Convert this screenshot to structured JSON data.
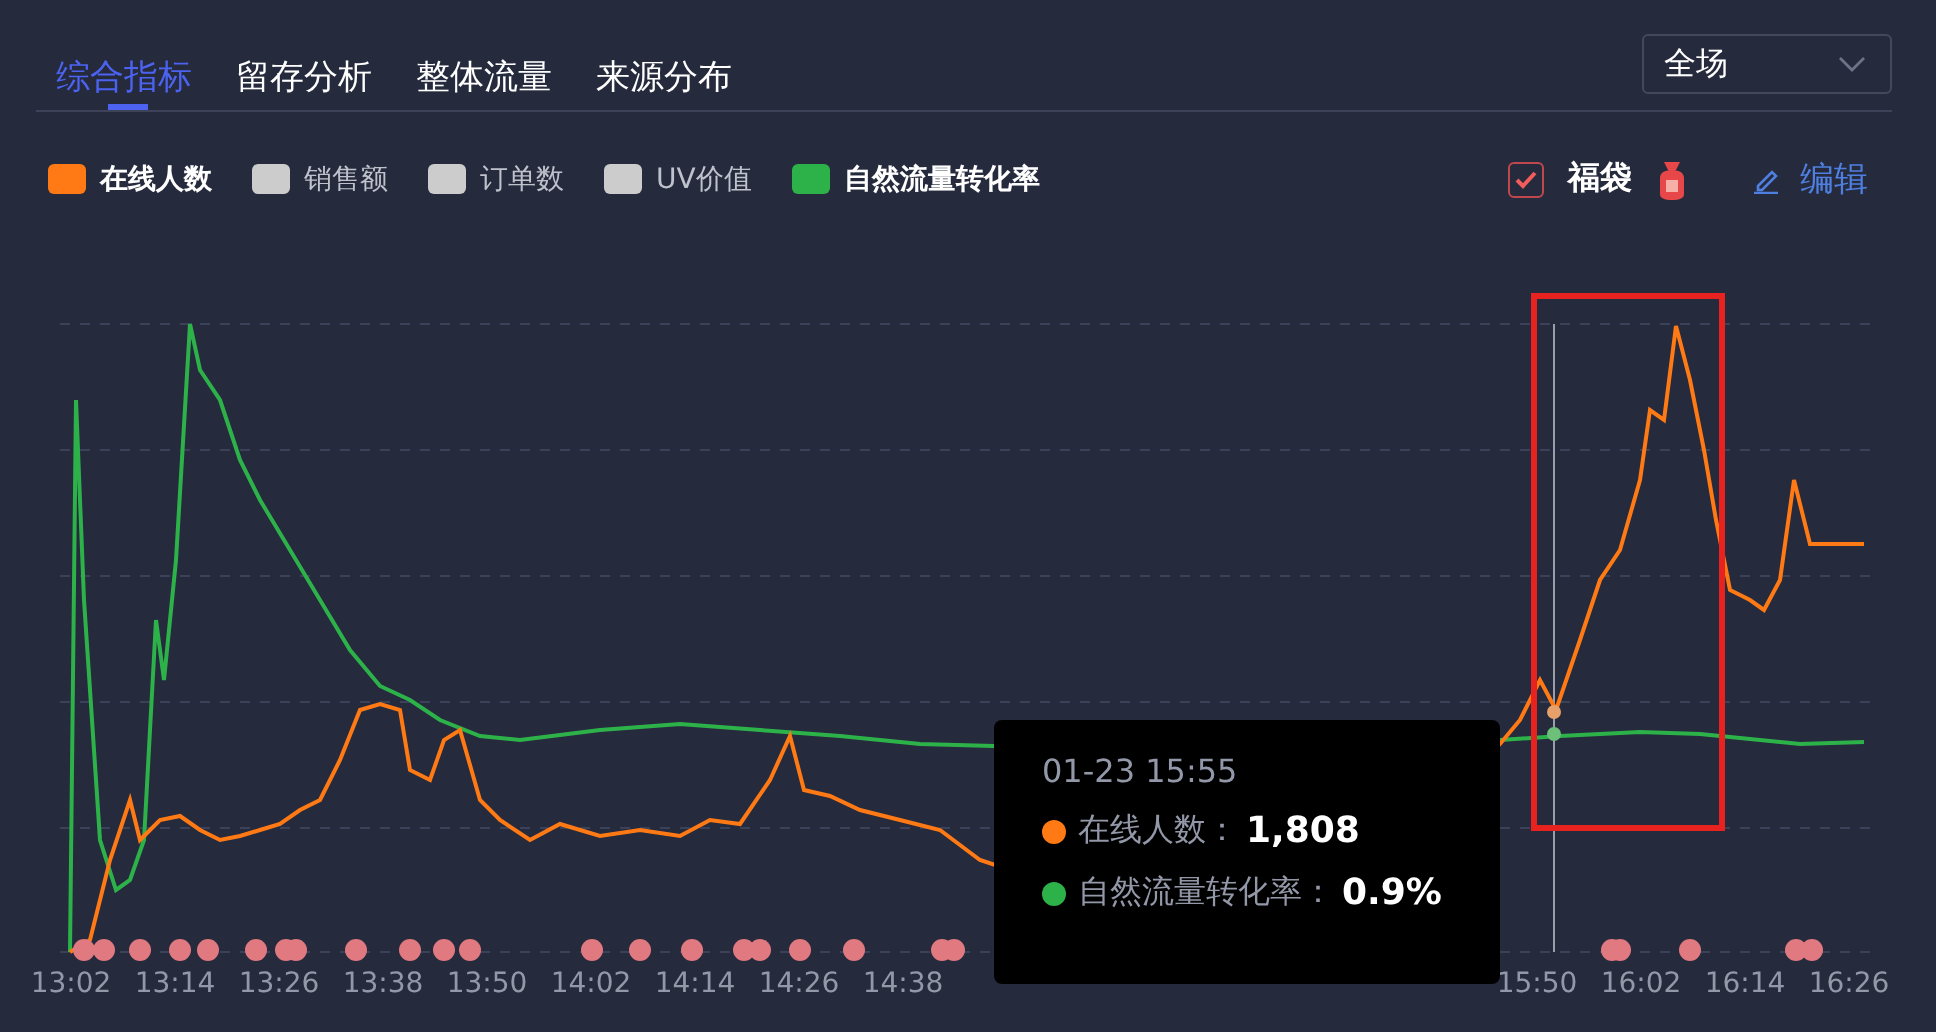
{
  "tabs": [
    {
      "label": "综合指标",
      "selected": true
    },
    {
      "label": "留存分析",
      "selected": false
    },
    {
      "label": "整体流量",
      "selected": false
    },
    {
      "label": "来源分布",
      "selected": false
    }
  ],
  "scope_select": {
    "value": "全场"
  },
  "legend": [
    {
      "label": "在线人数",
      "on": true,
      "color": "#ff7a14"
    },
    {
      "label": "销售额",
      "on": false
    },
    {
      "label": "订单数",
      "on": false
    },
    {
      "label": "UV价值",
      "on": false
    },
    {
      "label": "自然流量转化率",
      "on": true,
      "color": "#2db24a"
    }
  ],
  "lucky_bag": {
    "label": "福袋",
    "checked": true
  },
  "edit_button": {
    "label": "编辑"
  },
  "x_labels_left": [
    "13:02",
    "13:14",
    "13:26",
    "13:38",
    "13:50",
    "14:02",
    "14:14",
    "14:26",
    "14:38"
  ],
  "x_labels_right": [
    "15:50",
    "16:02",
    "16:14",
    "16:26"
  ],
  "tooltip": {
    "title": "01-23 15:55",
    "rows": [
      {
        "label": "在线人数：",
        "value": "1,808",
        "color": "#ff7a14"
      },
      {
        "label": "自然流量转化率：",
        "value": "0.9%",
        "color": "#2db24a"
      }
    ]
  }
}
